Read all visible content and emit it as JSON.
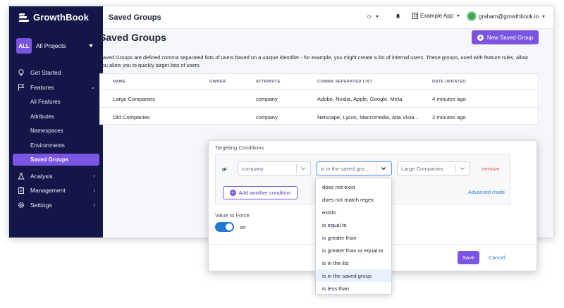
{
  "brand": {
    "name": "GrowthBook"
  },
  "project": {
    "badge": "ALL",
    "name": "All Projects"
  },
  "sidebar": {
    "items": [
      {
        "label": "Get Started",
        "icon": "lightbulb-icon"
      },
      {
        "label": "Features",
        "icon": "flag-icon",
        "expanded": true
      },
      {
        "label": "Analysis",
        "icon": "flask-icon"
      },
      {
        "label": "Management",
        "icon": "clipboard-icon"
      },
      {
        "label": "Settings",
        "icon": "gear-icon"
      }
    ],
    "feature_subitems": [
      "All Features",
      "Attributes",
      "Namespaces",
      "Environments",
      "Saved Groups"
    ],
    "active": "Saved Groups"
  },
  "topbar": {
    "title": "Saved Groups",
    "theme_icon": "sun-icon",
    "notification_icon": "bell-icon",
    "app_name": "Example App",
    "user_email": "graham@growthbook.io"
  },
  "page": {
    "title": "Saved Groups",
    "new_button": "New Saved Group",
    "description": "Saved Groups are defined comma separated lists of users based on a unique identifier - for example, you might create a list of internal users. These groups, used with feature rules, allow you allow you to quickly target lists of users."
  },
  "table": {
    "headers": [
      "NAME",
      "OWNER",
      "ATTRIBUTE",
      "COMMA SEPARATED LIST",
      "DATE UPDATED"
    ],
    "rows": [
      {
        "name": "Large Companies",
        "owner": "",
        "attribute": "company",
        "list": "Adobe, Nvidia, Apple, Google, Meta",
        "updated": "4 minutes ago"
      },
      {
        "name": "Old Companies",
        "owner": "",
        "attribute": "company",
        "list": "Netscape, Lycos, Macromedia, Alta Vista...",
        "updated": "2 minutes ago"
      }
    ]
  },
  "modal": {
    "section_title": "Targeting Conditions",
    "if_label": "IF",
    "attribute_value": "company",
    "operator_value": "is in the saved gro...",
    "group_value": "Large Companies",
    "remove_label": "remove",
    "add_condition_label": "Add another condition",
    "advanced_mode_label": "Advanced mode",
    "value_to_force_label": "Value to Force",
    "toggle_state_label": "on",
    "save_label": "Save",
    "cancel_label": "Cancel"
  },
  "operator_menu": {
    "options": [
      "does not exist",
      "does not match regex",
      "exists",
      "is equal to",
      "is greater than",
      "is greater than or equal to",
      "is in the list",
      "is in the saved group",
      "is less than"
    ],
    "highlighted": "is in the saved group"
  },
  "colors": {
    "sidebar_bg": "#141648",
    "accent": "#7a55e2",
    "link": "#2f7fd8",
    "danger": "#e05252",
    "toggle": "#2479d6"
  }
}
